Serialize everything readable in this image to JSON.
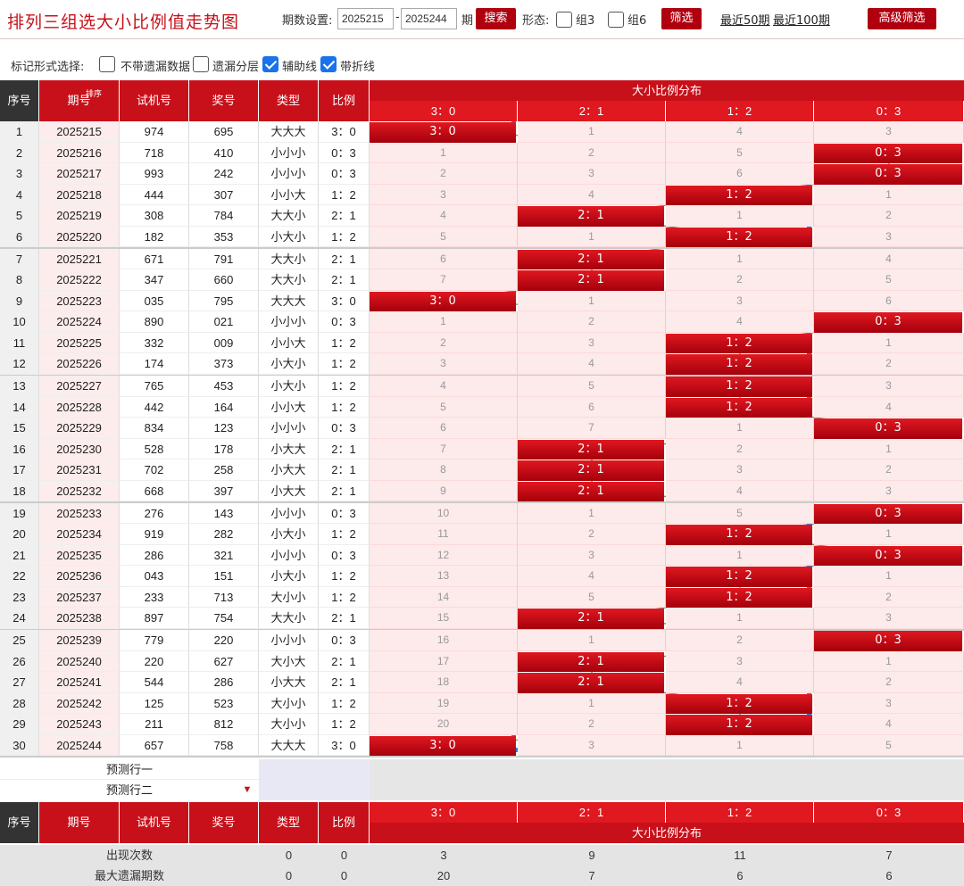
{
  "header": {
    "title": "排列三组选大小比例值走势图",
    "period_label": "期数设置:",
    "period_from": "2025215",
    "dash": "-",
    "period_to": "2025244",
    "period_suffix": "期",
    "search_label": "搜索",
    "form_label": "形态:",
    "group3": "组3",
    "group6": "组6",
    "filter_label": "筛选",
    "recent50": "最近50期",
    "recent100": "最近100期",
    "advanced_label": "高级筛选"
  },
  "options": {
    "label": "标记形式选择:",
    "items": [
      {
        "label": "不带遗漏数据",
        "checked": false
      },
      {
        "label": "遗漏分层",
        "checked": false
      },
      {
        "label": "辅助线",
        "checked": true
      },
      {
        "label": "带折线",
        "checked": true
      }
    ]
  },
  "table": {
    "columns": [
      "序号",
      "期号",
      "试机号",
      "奖号",
      "类型",
      "比例"
    ],
    "sort_label": "排序",
    "dist_title": "大小比例分布",
    "ratios": [
      "3：0",
      "2：1",
      "1：2",
      "0：3"
    ],
    "rows": [
      {
        "n": "1",
        "issue": "2025215",
        "trial": "974",
        "draw": "695",
        "type": "大大大",
        "ratio": "3：0",
        "hit": 0,
        "miss": [
          "",
          "1",
          "4",
          "3"
        ]
      },
      {
        "n": "2",
        "issue": "2025216",
        "trial": "718",
        "draw": "410",
        "type": "小小小",
        "ratio": "0：3",
        "hit": 3,
        "miss": [
          "1",
          "2",
          "5",
          ""
        ]
      },
      {
        "n": "3",
        "issue": "2025217",
        "trial": "993",
        "draw": "242",
        "type": "小小小",
        "ratio": "0：3",
        "hit": 3,
        "miss": [
          "2",
          "3",
          "6",
          ""
        ]
      },
      {
        "n": "4",
        "issue": "2025218",
        "trial": "444",
        "draw": "307",
        "type": "小小大",
        "ratio": "1：2",
        "hit": 2,
        "miss": [
          "3",
          "4",
          "",
          "1"
        ]
      },
      {
        "n": "5",
        "issue": "2025219",
        "trial": "308",
        "draw": "784",
        "type": "大大小",
        "ratio": "2：1",
        "hit": 1,
        "miss": [
          "4",
          "",
          "1",
          "2"
        ]
      },
      {
        "n": "6",
        "issue": "2025220",
        "trial": "182",
        "draw": "353",
        "type": "小大小",
        "ratio": "1：2",
        "hit": 2,
        "miss": [
          "5",
          "1",
          "",
          "3"
        ]
      },
      {
        "n": "7",
        "issue": "2025221",
        "trial": "671",
        "draw": "791",
        "type": "大大小",
        "ratio": "2：1",
        "hit": 1,
        "miss": [
          "6",
          "",
          "1",
          "4"
        ]
      },
      {
        "n": "8",
        "issue": "2025222",
        "trial": "347",
        "draw": "660",
        "type": "大大小",
        "ratio": "2：1",
        "hit": 1,
        "miss": [
          "7",
          "",
          "2",
          "5"
        ]
      },
      {
        "n": "9",
        "issue": "2025223",
        "trial": "035",
        "draw": "795",
        "type": "大大大",
        "ratio": "3：0",
        "hit": 0,
        "miss": [
          "",
          "1",
          "3",
          "6"
        ]
      },
      {
        "n": "10",
        "issue": "2025224",
        "trial": "890",
        "draw": "021",
        "type": "小小小",
        "ratio": "0：3",
        "hit": 3,
        "miss": [
          "1",
          "2",
          "4",
          ""
        ]
      },
      {
        "n": "11",
        "issue": "2025225",
        "trial": "332",
        "draw": "009",
        "type": "小小大",
        "ratio": "1：2",
        "hit": 2,
        "miss": [
          "2",
          "3",
          "",
          "1"
        ]
      },
      {
        "n": "12",
        "issue": "2025226",
        "trial": "174",
        "draw": "373",
        "type": "小大小",
        "ratio": "1：2",
        "hit": 2,
        "miss": [
          "3",
          "4",
          "",
          "2"
        ]
      },
      {
        "n": "13",
        "issue": "2025227",
        "trial": "765",
        "draw": "453",
        "type": "小大小",
        "ratio": "1：2",
        "hit": 2,
        "miss": [
          "4",
          "5",
          "",
          "3"
        ]
      },
      {
        "n": "14",
        "issue": "2025228",
        "trial": "442",
        "draw": "164",
        "type": "小小大",
        "ratio": "1：2",
        "hit": 2,
        "miss": [
          "5",
          "6",
          "",
          "4"
        ]
      },
      {
        "n": "15",
        "issue": "2025229",
        "trial": "834",
        "draw": "123",
        "type": "小小小",
        "ratio": "0：3",
        "hit": 3,
        "miss": [
          "6",
          "7",
          "1",
          ""
        ]
      },
      {
        "n": "16",
        "issue": "2025230",
        "trial": "528",
        "draw": "178",
        "type": "小大大",
        "ratio": "2：1",
        "hit": 1,
        "miss": [
          "7",
          "",
          "2",
          "1"
        ]
      },
      {
        "n": "17",
        "issue": "2025231",
        "trial": "702",
        "draw": "258",
        "type": "小大大",
        "ratio": "2：1",
        "hit": 1,
        "miss": [
          "8",
          "",
          "3",
          "2"
        ]
      },
      {
        "n": "18",
        "issue": "2025232",
        "trial": "668",
        "draw": "397",
        "type": "小大大",
        "ratio": "2：1",
        "hit": 1,
        "miss": [
          "9",
          "",
          "4",
          "3"
        ]
      },
      {
        "n": "19",
        "issue": "2025233",
        "trial": "276",
        "draw": "143",
        "type": "小小小",
        "ratio": "0：3",
        "hit": 3,
        "miss": [
          "10",
          "1",
          "5",
          ""
        ]
      },
      {
        "n": "20",
        "issue": "2025234",
        "trial": "919",
        "draw": "282",
        "type": "小大小",
        "ratio": "1：2",
        "hit": 2,
        "miss": [
          "11",
          "2",
          "",
          "1"
        ]
      },
      {
        "n": "21",
        "issue": "2025235",
        "trial": "286",
        "draw": "321",
        "type": "小小小",
        "ratio": "0：3",
        "hit": 3,
        "miss": [
          "12",
          "3",
          "1",
          ""
        ]
      },
      {
        "n": "22",
        "issue": "2025236",
        "trial": "043",
        "draw": "151",
        "type": "小大小",
        "ratio": "1：2",
        "hit": 2,
        "miss": [
          "13",
          "4",
          "",
          "1"
        ]
      },
      {
        "n": "23",
        "issue": "2025237",
        "trial": "233",
        "draw": "713",
        "type": "大小小",
        "ratio": "1：2",
        "hit": 2,
        "miss": [
          "14",
          "5",
          "",
          "2"
        ]
      },
      {
        "n": "24",
        "issue": "2025238",
        "trial": "897",
        "draw": "754",
        "type": "大大小",
        "ratio": "2：1",
        "hit": 1,
        "miss": [
          "15",
          "",
          "1",
          "3"
        ]
      },
      {
        "n": "25",
        "issue": "2025239",
        "trial": "779",
        "draw": "220",
        "type": "小小小",
        "ratio": "0：3",
        "hit": 3,
        "miss": [
          "16",
          "1",
          "2",
          ""
        ]
      },
      {
        "n": "26",
        "issue": "2025240",
        "trial": "220",
        "draw": "627",
        "type": "大小大",
        "ratio": "2：1",
        "hit": 1,
        "miss": [
          "17",
          "",
          "3",
          "1"
        ]
      },
      {
        "n": "27",
        "issue": "2025241",
        "trial": "544",
        "draw": "286",
        "type": "小大大",
        "ratio": "2：1",
        "hit": 1,
        "miss": [
          "18",
          "",
          "4",
          "2"
        ]
      },
      {
        "n": "28",
        "issue": "2025242",
        "trial": "125",
        "draw": "523",
        "type": "大小小",
        "ratio": "1：2",
        "hit": 2,
        "miss": [
          "19",
          "1",
          "",
          "3"
        ]
      },
      {
        "n": "29",
        "issue": "2025243",
        "trial": "211",
        "draw": "812",
        "type": "大小小",
        "ratio": "1：2",
        "hit": 2,
        "miss": [
          "20",
          "2",
          "",
          "4"
        ]
      },
      {
        "n": "30",
        "issue": "2025244",
        "trial": "657",
        "draw": "758",
        "type": "大大大",
        "ratio": "3：0",
        "hit": 0,
        "miss": [
          "",
          "3",
          "1",
          "5"
        ]
      }
    ],
    "predict1": "预测行一",
    "predict2": "预测行二",
    "stats": [
      {
        "label": "出现次数",
        "a": "0",
        "b": "0",
        "v": [
          "3",
          "9",
          "11",
          "7"
        ]
      },
      {
        "label": "最大遗漏期数",
        "a": "0",
        "b": "0",
        "v": [
          "20",
          "7",
          "6",
          "6"
        ]
      }
    ]
  },
  "colors": {
    "accent": "#c8101a",
    "highlight": "#2480e8"
  }
}
